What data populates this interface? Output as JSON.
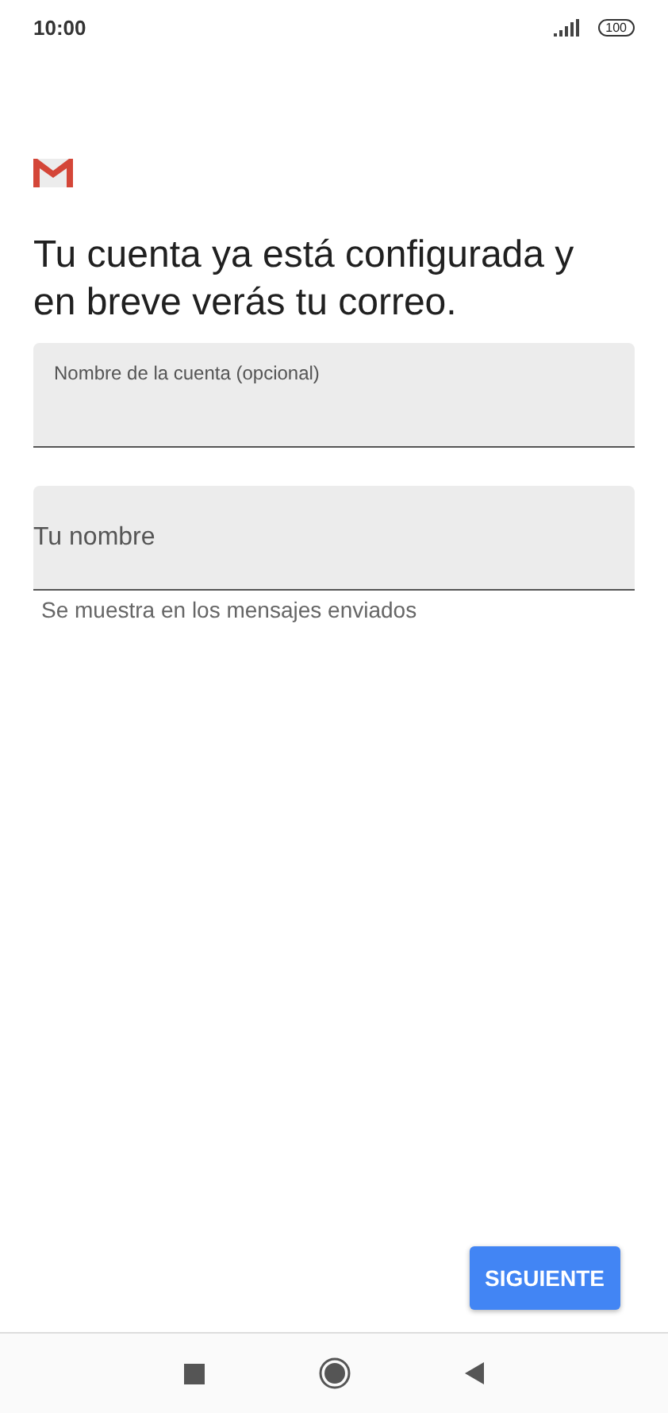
{
  "status_bar": {
    "time": "10:00",
    "battery": "100"
  },
  "heading": "Tu cuenta ya está configurada y en breve verás tu correo.",
  "fields": [
    {
      "label": "Nombre de la cuenta (opcional)"
    },
    {
      "placeholder": "Tu nombre",
      "helper": "Se muestra en los mensajes enviados"
    }
  ],
  "next_button": "SIGUIENTE"
}
